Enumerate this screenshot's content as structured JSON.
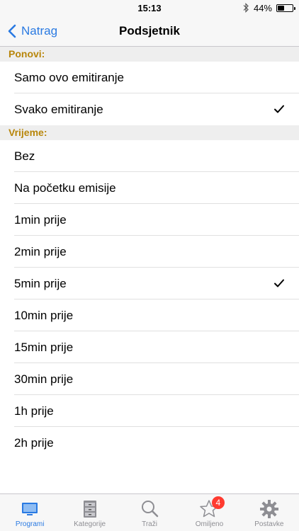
{
  "status_bar": {
    "time": "15:13",
    "battery": "44%",
    "battery_level": 0.44
  },
  "nav": {
    "back_label": "Natrag",
    "title": "Podsjetnik"
  },
  "sections": [
    {
      "header": "Ponovi:",
      "items": [
        {
          "label": "Samo ovo emitiranje",
          "checked": false
        },
        {
          "label": "Svako emitiranje",
          "checked": true
        }
      ]
    },
    {
      "header": "Vrijeme:",
      "items": [
        {
          "label": "Bez",
          "checked": false
        },
        {
          "label": "Na početku emisije",
          "checked": false
        },
        {
          "label": "1min prije",
          "checked": false
        },
        {
          "label": "2min prije",
          "checked": false
        },
        {
          "label": "5min prije",
          "checked": true
        },
        {
          "label": "10min prije",
          "checked": false
        },
        {
          "label": "15min prije",
          "checked": false
        },
        {
          "label": "30min prije",
          "checked": false
        },
        {
          "label": "1h prije",
          "checked": false
        },
        {
          "label": "2h prije",
          "checked": false
        }
      ]
    }
  ],
  "tabs": [
    {
      "label": "Programi",
      "icon": "tv-icon",
      "active": true
    },
    {
      "label": "Kategorije",
      "icon": "cabinet-icon",
      "active": false
    },
    {
      "label": "Traži",
      "icon": "search-icon",
      "active": false
    },
    {
      "label": "Omiljeno",
      "icon": "star-icon",
      "active": false,
      "badge": "4"
    },
    {
      "label": "Postavke",
      "icon": "gear-icon",
      "active": false
    }
  ],
  "colors": {
    "accent": "#2a7ae2",
    "section_header_text": "#b8860b",
    "badge": "#ff3b30",
    "inactive_tab": "#8e8e93"
  }
}
